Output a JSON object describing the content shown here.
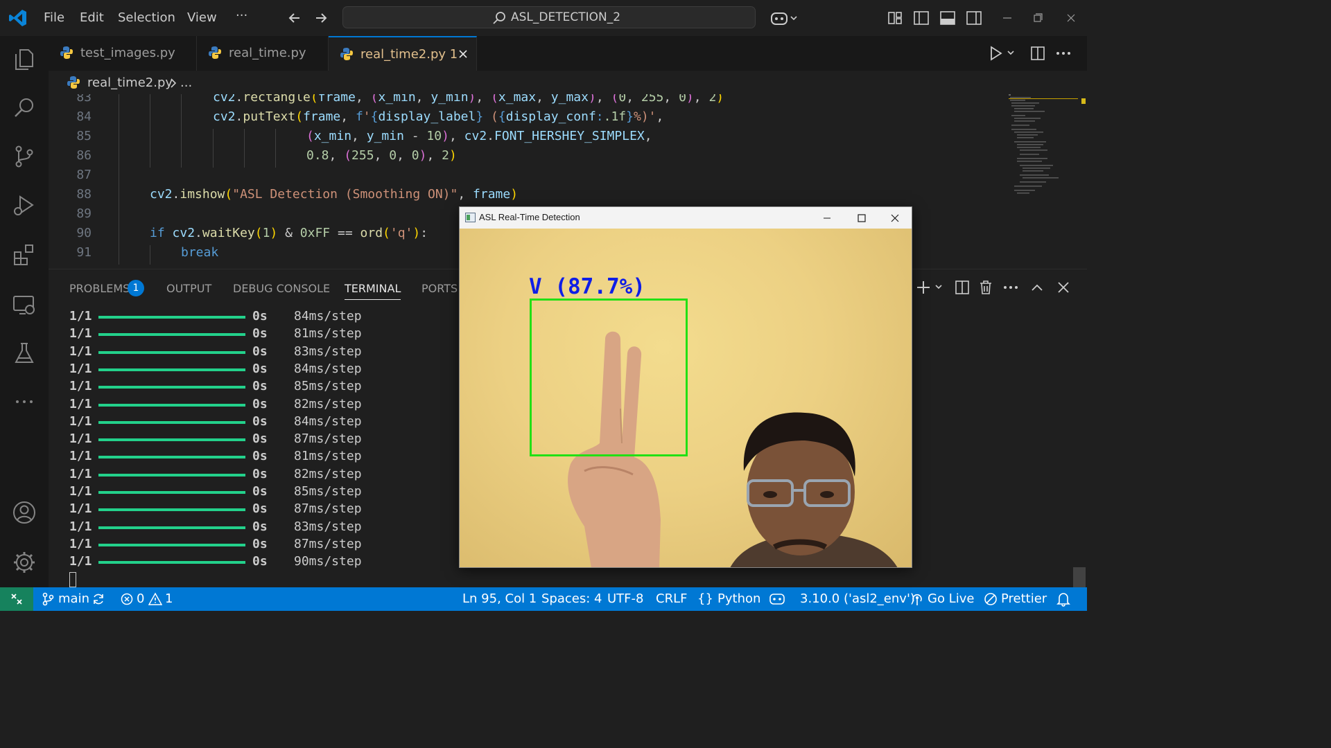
{
  "titlebar": {
    "menu": [
      "File",
      "Edit",
      "Selection",
      "View",
      "···"
    ],
    "search_text": "ASL_DETECTION_2"
  },
  "tabs": [
    {
      "label": "test_images.py",
      "active": false
    },
    {
      "label": "real_time.py",
      "active": false
    },
    {
      "label": "real_time2.py 1",
      "active": true
    }
  ],
  "breadcrumb": {
    "file": "real_time2.py",
    "rest": "..."
  },
  "editor": {
    "line_numbers": [
      "83",
      "84",
      "85",
      "86",
      "87",
      "88",
      "89",
      "90",
      "91"
    ]
  },
  "panel": {
    "tabs": [
      "PROBLEMS",
      "OUTPUT",
      "DEBUG CONSOLE",
      "TERMINAL",
      "PORTS"
    ],
    "problems_count": "1",
    "active_tab": "TERMINAL",
    "terminal_lines": [
      {
        "progress": "1/1",
        "time": "0s",
        "step": "84ms/step"
      },
      {
        "progress": "1/1",
        "time": "0s",
        "step": "81ms/step"
      },
      {
        "progress": "1/1",
        "time": "0s",
        "step": "83ms/step"
      },
      {
        "progress": "1/1",
        "time": "0s",
        "step": "84ms/step"
      },
      {
        "progress": "1/1",
        "time": "0s",
        "step": "85ms/step"
      },
      {
        "progress": "1/1",
        "time": "0s",
        "step": "82ms/step"
      },
      {
        "progress": "1/1",
        "time": "0s",
        "step": "84ms/step"
      },
      {
        "progress": "1/1",
        "time": "0s",
        "step": "87ms/step"
      },
      {
        "progress": "1/1",
        "time": "0s",
        "step": "81ms/step"
      },
      {
        "progress": "1/1",
        "time": "0s",
        "step": "82ms/step"
      },
      {
        "progress": "1/1",
        "time": "0s",
        "step": "85ms/step"
      },
      {
        "progress": "1/1",
        "time": "0s",
        "step": "87ms/step"
      },
      {
        "progress": "1/1",
        "time": "0s",
        "step": "83ms/step"
      },
      {
        "progress": "1/1",
        "time": "0s",
        "step": "87ms/step"
      },
      {
        "progress": "1/1",
        "time": "0s",
        "step": "90ms/step"
      }
    ]
  },
  "popup": {
    "title": "ASL Real-Time Detection",
    "detection_label": "V (87.7%)"
  },
  "statusbar": {
    "branch": "main",
    "errors": "0",
    "warnings": "1",
    "position": "Ln 95, Col 1",
    "spaces": "Spaces: 4",
    "encoding": "UTF-8",
    "eol": "CRLF",
    "language_braces": "{}",
    "language": "Python",
    "interpreter": "3.10.0 ('asl2_env')",
    "go_live": "Go Live",
    "prettier": "Prettier"
  },
  "colors": {
    "accent": "#0078d4",
    "terminal_bar": "#23d18b",
    "box_green": "#22e014",
    "label_blue": "#0f1ee6"
  }
}
